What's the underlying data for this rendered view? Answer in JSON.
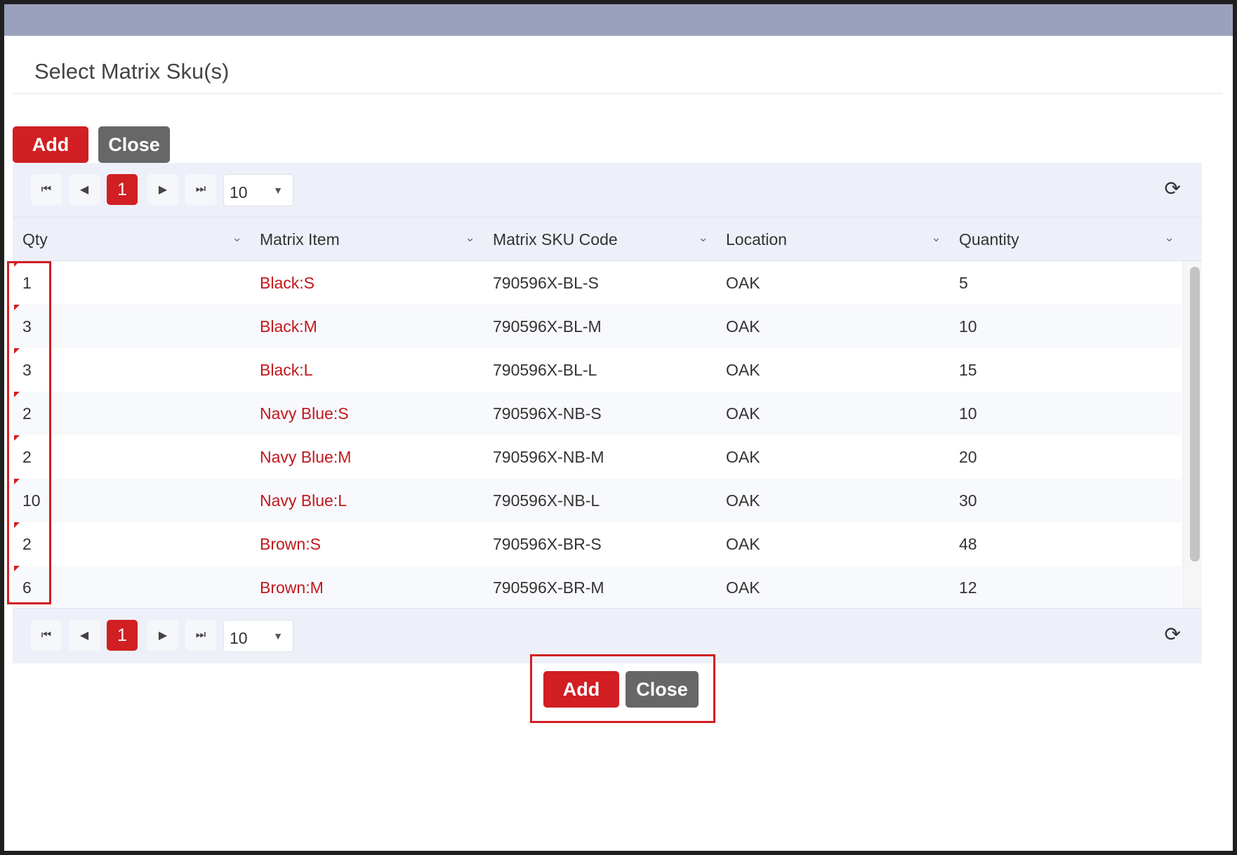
{
  "dialog": {
    "title": "Select Matrix Sku(s)"
  },
  "top_actions": {
    "add_label": "Add",
    "close_label": "Close"
  },
  "bottom_actions": {
    "add_label": "Add",
    "close_label": "Close"
  },
  "pager": {
    "current_page": "1",
    "page_size": "10",
    "icons": [
      "first-page-icon",
      "prev-page-icon",
      "next-page-icon",
      "last-page-icon",
      "refresh-icon"
    ]
  },
  "columns": [
    "Qty",
    "Matrix Item",
    "Matrix SKU Code",
    "Location",
    "Quantity"
  ],
  "rows": [
    {
      "qty": "1",
      "item": "Black:S",
      "sku": "790596X-BL-S",
      "location": "OAK",
      "quantity": "5"
    },
    {
      "qty": "3",
      "item": "Black:M",
      "sku": "790596X-BL-M",
      "location": "OAK",
      "quantity": "10"
    },
    {
      "qty": "3",
      "item": "Black:L",
      "sku": "790596X-BL-L",
      "location": "OAK",
      "quantity": "15"
    },
    {
      "qty": "2",
      "item": "Navy Blue:S",
      "sku": "790596X-NB-S",
      "location": "OAK",
      "quantity": "10"
    },
    {
      "qty": "2",
      "item": "Navy Blue:M",
      "sku": "790596X-NB-M",
      "location": "OAK",
      "quantity": "20"
    },
    {
      "qty": "10",
      "item": "Navy Blue:L",
      "sku": "790596X-NB-L",
      "location": "OAK",
      "quantity": "30"
    },
    {
      "qty": "2",
      "item": "Brown:S",
      "sku": "790596X-BR-S",
      "location": "OAK",
      "quantity": "48"
    },
    {
      "qty": "6",
      "item": "Brown:M",
      "sku": "790596X-BR-M",
      "location": "OAK",
      "quantity": "12"
    }
  ],
  "colors": {
    "accent": "#d11f23",
    "link": "#c0181c",
    "titlebar": "#9aa1bd",
    "grid_header": "#eef0f9",
    "close_button": "#676767"
  }
}
